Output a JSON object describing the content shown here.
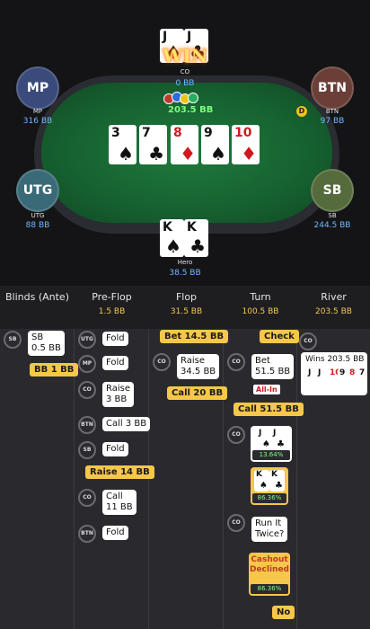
{
  "colors": {
    "accent": "#f6c74a",
    "stack": "#6fb8ff",
    "pot": "#7dff7d"
  },
  "table": {
    "win_text": "WIN",
    "pot": "203.5 BB",
    "dealer": "D",
    "seats": {
      "mp": {
        "badge": "MP",
        "label": "MP",
        "stack": "316 BB",
        "color": "#3a4a7a"
      },
      "btn": {
        "badge": "BTN",
        "label": "BTN",
        "stack": "97 BB",
        "color": "#6a3f38"
      },
      "utg": {
        "badge": "UTG",
        "label": "UTG",
        "stack": "88 BB",
        "color": "#3a6a78"
      },
      "sb": {
        "badge": "SB",
        "label": "SB",
        "stack": "244.5 BB",
        "color": "#556b3b"
      },
      "co": {
        "label": "CO",
        "stack": "0 BB"
      },
      "hero": {
        "label": "Hero",
        "stack": "38.5 BB"
      }
    },
    "co_cards": [
      {
        "rank": "J",
        "suit": "♠"
      },
      {
        "rank": "J",
        "suit": "♣"
      }
    ],
    "hero_cards": [
      {
        "rank": "K",
        "suit": "♠"
      },
      {
        "rank": "K",
        "suit": "♣"
      }
    ],
    "board": [
      {
        "rank": "3",
        "suit": "♠",
        "red": false
      },
      {
        "rank": "7",
        "suit": "♣",
        "red": false
      },
      {
        "rank": "8",
        "suit": "♦",
        "red": true
      },
      {
        "rank": "9",
        "suit": "♠",
        "red": false
      },
      {
        "rank": "10",
        "suit": "♦",
        "red": true
      }
    ]
  },
  "history": {
    "columns": [
      {
        "title": "Blinds (Ante)",
        "pot": ""
      },
      {
        "title": "Pre-Flop",
        "pot": "1.5 BB"
      },
      {
        "title": "Flop",
        "pot": "31.5 BB"
      },
      {
        "title": "Turn",
        "pot": "100.5 BB"
      },
      {
        "title": "River",
        "pot": "203.5 BB"
      }
    ],
    "blinds": {
      "sb_chip": "SB",
      "sb_action": "SB\n0.5 BB",
      "bb_action": "BB 1 BB"
    },
    "preflop": {
      "utg_chip": "UTG",
      "utg_action": "Fold",
      "mp_chip": "MP",
      "mp_action": "Fold",
      "co_chip": "CO",
      "co_action": "Raise\n3 BB",
      "btn_chip": "BTN",
      "btn_action": "Call 3 BB",
      "sb_chip": "SB",
      "sb_action": "Fold",
      "hero_raise": "Raise 14 BB",
      "co2_chip": "CO",
      "co2_action": "Call\n11 BB",
      "btn2_chip": "BTN",
      "btn2_action": "Fold"
    },
    "flop": {
      "hero_bet": "Bet 14.5 BB",
      "co_chip": "CO",
      "co_action": "Raise\n34.5 BB",
      "hero_call": "Call 20 BB"
    },
    "turn": {
      "hero_check": "Check",
      "co_chip": "CO",
      "co_action": "Bet\n51.5 BB",
      "allin": "All-In",
      "hero_call": "Call 51.5 BB",
      "co2_chip": "CO",
      "co_equity": "13.64%",
      "hero_equity": "86.36%",
      "co3_chip": "CO",
      "co_runit": "Run It\nTwice?",
      "cashout": "Cashout\nDeclined",
      "cashout_equity": "86.36%",
      "hero_no": "No"
    },
    "river": {
      "co_chip": "CO",
      "wins": "Wins 203.5 BB"
    }
  }
}
